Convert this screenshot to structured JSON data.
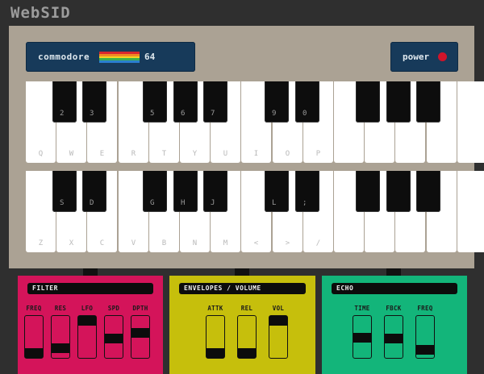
{
  "app": {
    "title": "WebSID"
  },
  "brand": {
    "left": "commodore",
    "right": "64",
    "rainbow": [
      "#d9272e",
      "#f08a24",
      "#f5d321",
      "#3fb24a",
      "#2a7fd0"
    ]
  },
  "power": {
    "label": "power",
    "led_color": "#d0142a"
  },
  "keyboards": [
    {
      "white": [
        "Q",
        "W",
        "E",
        "R",
        "T",
        "Y",
        "U",
        "I",
        "O",
        "P",
        "",
        "",
        "",
        "",
        ""
      ],
      "black": [
        "2",
        "3",
        "",
        "5",
        "6",
        "7",
        "",
        "9",
        "0",
        "",
        "",
        ""
      ]
    },
    {
      "white": [
        "Z",
        "X",
        "C",
        "V",
        "B",
        "N",
        "M",
        "<",
        ">",
        "/",
        "",
        "",
        "",
        "",
        ""
      ],
      "black": [
        "S",
        "D",
        "",
        "G",
        "H",
        "J",
        "",
        "L",
        ";",
        "",
        "",
        ""
      ]
    }
  ],
  "panels": [
    {
      "title": "FILTER",
      "color": "#d4145a",
      "sliders": [
        {
          "label": "FREQ",
          "value": 0.0
        },
        {
          "label": "RES",
          "value": 0.15
        },
        {
          "label": "LFO",
          "value": 1.0
        },
        {
          "label": "SPD",
          "value": 0.45
        },
        {
          "label": "DPTH",
          "value": 0.62
        }
      ]
    },
    {
      "title": "ENVELOPES / VOLUME",
      "color": "#c6bf0c",
      "sliders": [
        {
          "label": "ATTK",
          "value": 0.0
        },
        {
          "label": "REL",
          "value": 0.0
        },
        {
          "label": "VOL",
          "value": 1.0
        }
      ]
    },
    {
      "title": "ECHO",
      "color": "#13b57a",
      "sliders": [
        {
          "label": "TIME",
          "value": 0.47
        },
        {
          "label": "FBCK",
          "value": 0.45
        },
        {
          "label": "FREQ",
          "value": 0.1
        }
      ]
    }
  ]
}
